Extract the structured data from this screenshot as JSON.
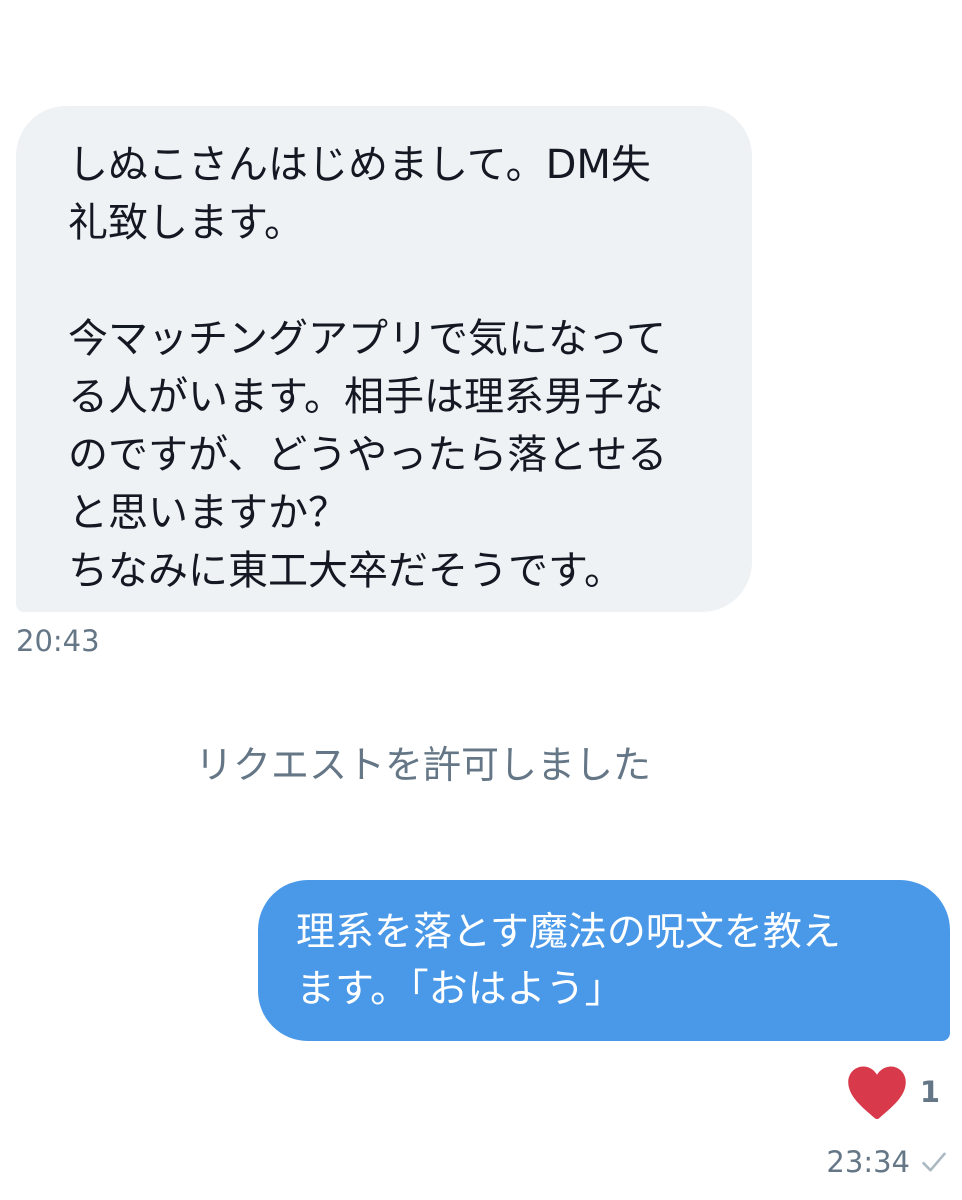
{
  "conversation": {
    "incoming": {
      "paragraphs": [
        "しぬこさんはじめまして。DM失\n礼致します。",
        "今マッチングアプリで気になって\nる人がいます。相手は理系男子な\nのですが、どうやったら落とせる\nと思いますか？\nちなみに東工大卒だそうです。"
      ],
      "timestamp": "20:43",
      "bubble_color": "#eff2f4"
    },
    "system_notice": "リクエストを許可しました",
    "outgoing": {
      "text": "理系を落とす魔法の呪文を教え\nます。「おはよう」",
      "like_count": "1",
      "timestamp": "23:34",
      "bubble_color": "#4a99e9",
      "like_icon": "heart-icon",
      "status_icon": "check-icon",
      "heart_color": "#e0245e"
    }
  }
}
